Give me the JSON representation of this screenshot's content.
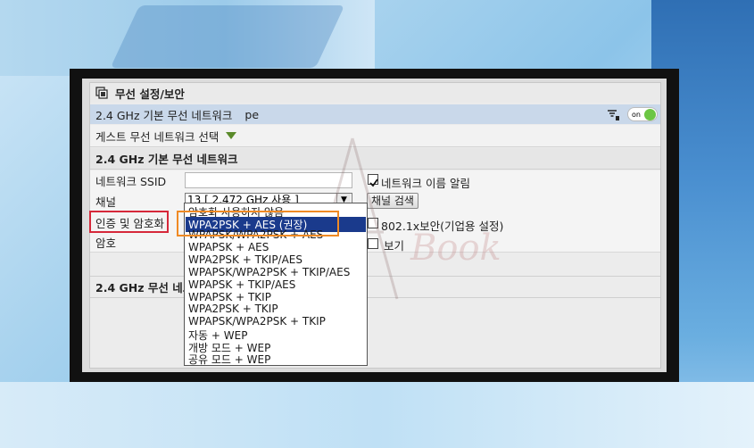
{
  "window_title": "무선 설정/보안",
  "band": {
    "label": "2.4 GHz 기본 무선 네트워크",
    "ssid_name": "pe",
    "toggle_label": "on"
  },
  "guest": {
    "label": "게스트 무선 네트워크 선택"
  },
  "section_title": "2.4 GHz 기본 무선 네트워크",
  "fields": {
    "ssid_label": "네트워크 SSID",
    "ssid_value": "",
    "broadcast_label": "네트워크 이름 알림",
    "channel_label": "채널",
    "channel_value": "13 [ 2.472 GHz 사용 ]",
    "channel_search": "채널 검색",
    "auth_label": "인증 및 암호화",
    "enterprise_label": "802.1x보안(기업용 설정)",
    "enc_label": "암호",
    "show_label": "보기"
  },
  "lower_section_title": "2.4 GHz 무선 네트",
  "watermark": "Book",
  "auth_options": [
    "암호화 사용하지 않음",
    "WPA2PSK + AES (권장)",
    "WPAPSK/WPA2PSK + AES",
    "WPAPSK + AES",
    "WPA2PSK + TKIP/AES",
    "WPAPSK/WPA2PSK + TKIP/AES",
    "WPAPSK + TKIP/AES",
    "WPAPSK + TKIP",
    "WPA2PSK + TKIP",
    "WPAPSK/WPA2PSK + TKIP",
    "자동 + WEP",
    "개방 모드 + WEP",
    "공유 모드 + WEP"
  ],
  "selected_option": "WPA2PSK + AES (권장)",
  "colors": {
    "highlight": "#1a3a8c",
    "red_box": "#d6283a",
    "orange_box": "#f08a24",
    "toggle_on": "#6cc644"
  },
  "icons": [
    "settings-window-icon",
    "filter-icon",
    "chevron-down-icon",
    "dropdown-arrow-icon",
    "checkbox-checked-icon"
  ]
}
